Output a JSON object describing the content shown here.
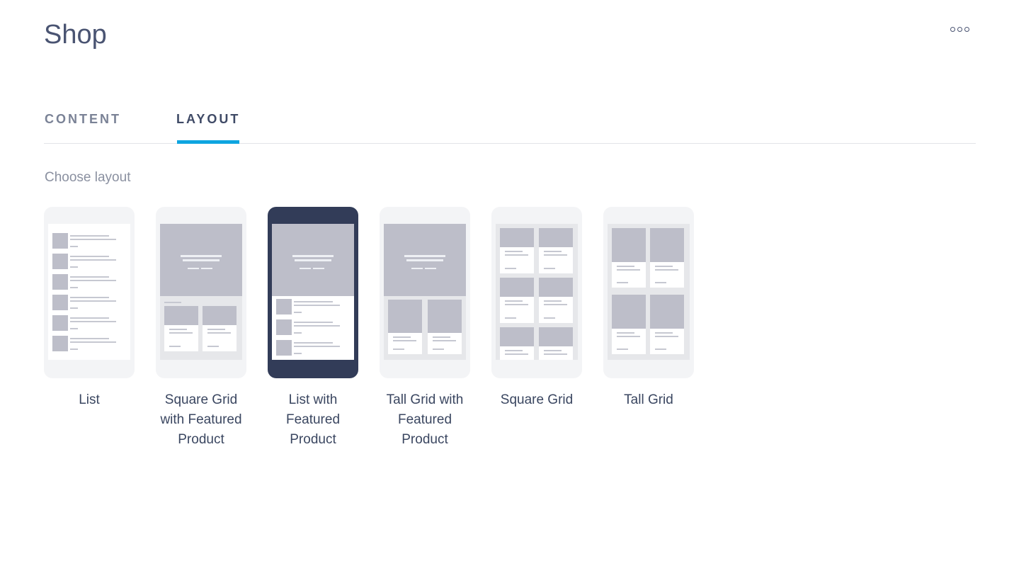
{
  "header": {
    "title": "Shop",
    "more_icon": "more-horizontal-icon"
  },
  "tabs": [
    {
      "label": "CONTENT",
      "active": false
    },
    {
      "label": "LAYOUT",
      "active": true
    }
  ],
  "accent_color": "#0ea5e0",
  "section_label": "Choose layout",
  "layouts": [
    {
      "label": "List",
      "type": "list",
      "selected": false
    },
    {
      "label": "Square Grid with Featured Product",
      "type": "square-featured",
      "selected": false
    },
    {
      "label": "List with Featured Product",
      "type": "list-featured",
      "selected": true
    },
    {
      "label": "Tall Grid with Featured Product",
      "type": "tall-featured",
      "selected": false
    },
    {
      "label": "Square Grid",
      "type": "square-grid",
      "selected": false
    },
    {
      "label": "Tall Grid",
      "type": "tall-grid",
      "selected": false
    }
  ]
}
